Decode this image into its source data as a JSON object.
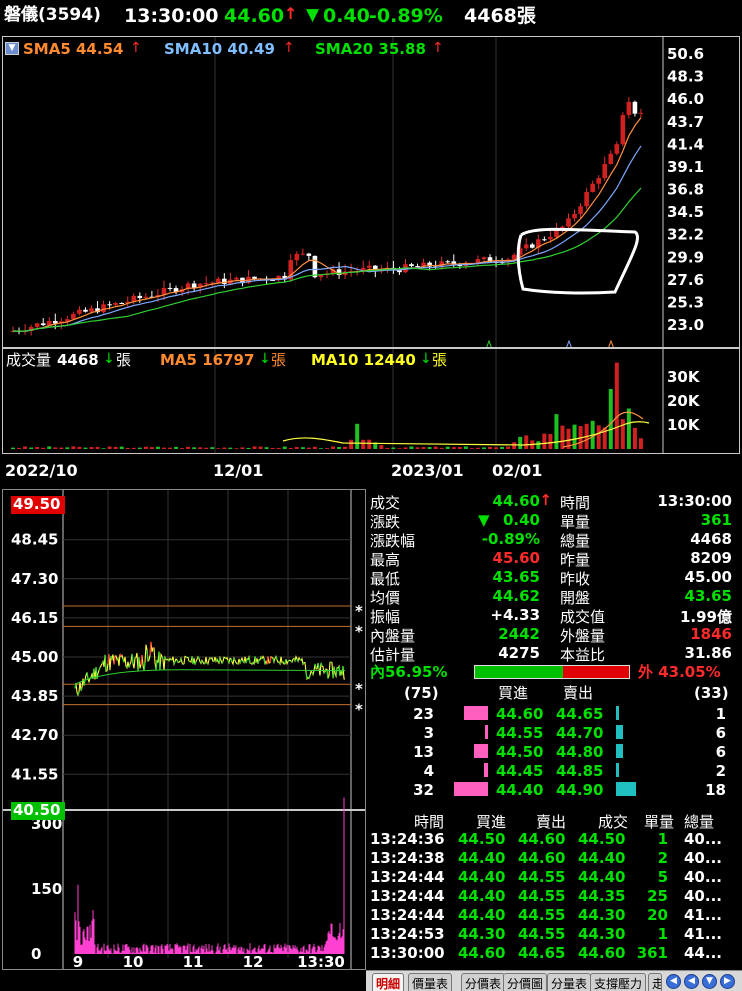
{
  "header": {
    "name": "磐儀(3594)",
    "time": "13:30:00",
    "price": "44.60",
    "change": "0.40",
    "pct": "-0.89%",
    "vol": "4468張"
  },
  "kchart": {
    "sma5": "SMA5 44.54",
    "sma10": "SMA10 40.49",
    "sma20": "SMA20 35.88",
    "yticks": [
      "50.6",
      "48.3",
      "46.0",
      "43.7",
      "41.4",
      "39.1",
      "36.8",
      "34.5",
      "32.2",
      "29.9",
      "27.6",
      "25.3",
      "23.0"
    ]
  },
  "volchart": {
    "label": "成交量",
    "value": "4468",
    "unit": "張",
    "ma5": "MA5 16797",
    "ma10": "MA10 12440",
    "unit2": "張",
    "yticks": [
      "30K",
      "20K",
      "10K"
    ],
    "dates": [
      "2022/10",
      "12/01",
      "2023/01",
      "02/01"
    ]
  },
  "intraday": {
    "yticks": [
      "49.50",
      "48.45",
      "47.30",
      "46.15",
      "45.00",
      "43.85",
      "42.70",
      "41.55",
      "40.50"
    ],
    "vticks": [
      "300",
      "150",
      "0"
    ],
    "xticks": [
      "9",
      "10",
      "11",
      "12",
      "13:30"
    ]
  },
  "quote": {
    "left": [
      [
        "成交",
        "44.60"
      ],
      [
        "漲跌",
        "0.40"
      ],
      [
        "漲跌幅",
        "-0.89%"
      ],
      [
        "最高",
        "45.60"
      ],
      [
        "最低",
        "43.65"
      ],
      [
        "均價",
        "44.62"
      ],
      [
        "振幅",
        "+4.33"
      ],
      [
        "內盤量",
        "2442"
      ],
      [
        "估計量",
        "4275"
      ]
    ],
    "right": [
      [
        "時間",
        "13:30:00"
      ],
      [
        "單量",
        "361"
      ],
      [
        "總量",
        "4468"
      ],
      [
        "昨量",
        "8209"
      ],
      [
        "昨收",
        "45.00"
      ],
      [
        "開盤",
        "43.65"
      ],
      [
        "成交值",
        "1.99億"
      ],
      [
        "外盤量",
        "1846"
      ],
      [
        "本益比",
        "31.86"
      ]
    ],
    "inner": "內56.95%",
    "outer": "外 43.05%",
    "inner_pct": 0.5695
  },
  "book": {
    "buy_total": "(75)",
    "sell_total": "(33)",
    "hdr_buy": "買進",
    "hdr_sell": "賣出",
    "rows": [
      [
        "23",
        "44.60",
        "44.65",
        "1"
      ],
      [
        "3",
        "44.55",
        "44.70",
        "6"
      ],
      [
        "13",
        "44.50",
        "44.80",
        "6"
      ],
      [
        "4",
        "44.45",
        "44.85",
        "2"
      ],
      [
        "32",
        "44.40",
        "44.90",
        "18"
      ]
    ]
  },
  "ticks": {
    "headers": [
      "時間",
      "買進",
      "賣出",
      "成交",
      "單量",
      "總量"
    ],
    "rows": [
      [
        "13:24:36",
        "44.50",
        "44.60",
        "44.50",
        "1",
        "40..."
      ],
      [
        "13:24:38",
        "44.40",
        "44.60",
        "44.40",
        "2",
        "40..."
      ],
      [
        "13:24:44",
        "44.40",
        "44.55",
        "44.40",
        "5",
        "40..."
      ],
      [
        "13:24:44",
        "44.40",
        "44.55",
        "44.35",
        "25",
        "40..."
      ],
      [
        "13:24:44",
        "44.40",
        "44.55",
        "44.30",
        "20",
        "41..."
      ],
      [
        "13:24:53",
        "44.30",
        "44.55",
        "44.30",
        "1",
        "41..."
      ],
      [
        "13:30:00",
        "44.60",
        "44.65",
        "44.60",
        "361",
        "44..."
      ]
    ]
  },
  "tabs": [
    "明細",
    "價量表",
    "分價表",
    "分價圖",
    "分量表",
    "支撐壓力",
    "走"
  ]
}
